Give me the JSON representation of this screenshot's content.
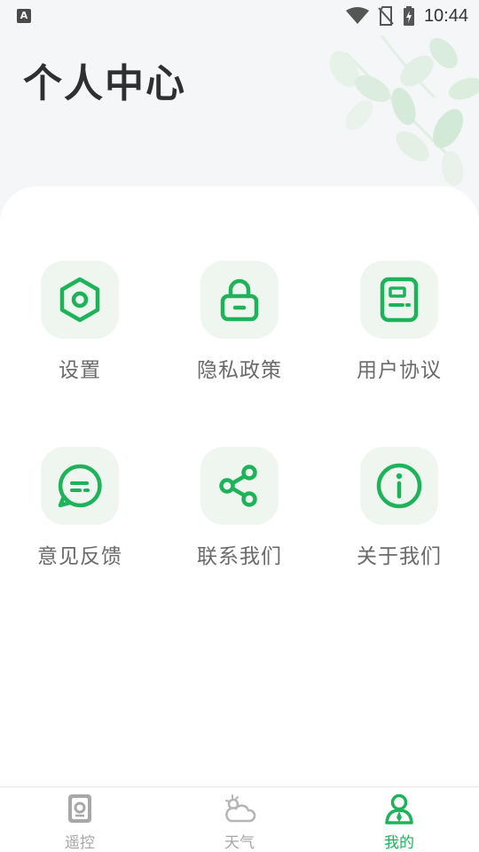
{
  "status_bar": {
    "time": "10:44",
    "left_badge": "A"
  },
  "header": {
    "title": "个人中心"
  },
  "menu": [
    {
      "label": "设置",
      "icon": "settings-hexagon-icon"
    },
    {
      "label": "隐私政策",
      "icon": "lock-icon"
    },
    {
      "label": "用户协议",
      "icon": "document-icon"
    },
    {
      "label": "意见反馈",
      "icon": "feedback-chat-icon"
    },
    {
      "label": "联系我们",
      "icon": "share-icon"
    },
    {
      "label": "关于我们",
      "icon": "info-icon"
    }
  ],
  "bottom_nav": [
    {
      "label": "遥控",
      "icon": "remote-icon",
      "active": false
    },
    {
      "label": "天气",
      "icon": "weather-icon",
      "active": false
    },
    {
      "label": "我的",
      "icon": "profile-icon",
      "active": true
    }
  ],
  "colors": {
    "accent": "#1eb35a",
    "icon_bg": "#eef6ef",
    "page_bg": "#f4f6f8"
  }
}
